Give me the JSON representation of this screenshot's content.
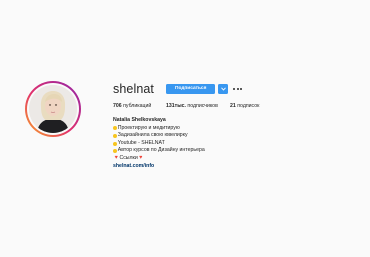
{
  "profile": {
    "username": "shelnat",
    "follow_label": "Подписаться",
    "posts_count": "706",
    "posts_label": "публикаций",
    "followers_count": "131тыс.",
    "followers_label": "подписчиков",
    "following_count": "21",
    "following_label": "подписок"
  },
  "bio": {
    "name": "Natalia Shelkovskaya",
    "lines": [
      "Проектирую и медитирую",
      "Задизайнила свою ювелирку",
      "Youtube - SHELNAT",
      "Автор курсов по Дизайну интерьера"
    ],
    "links_line": "🔻Ссылки🔻",
    "link": "shelnat.com/info"
  },
  "icons": {
    "avatar": "avatar-photo",
    "dropdown": "chevron-down-icon",
    "more": "more-options-icon",
    "bullet": "yellow-dot-icon"
  },
  "colors": {
    "background": "#fafafa",
    "accent": "#3897f0",
    "link": "#003569",
    "text": "#262626"
  }
}
